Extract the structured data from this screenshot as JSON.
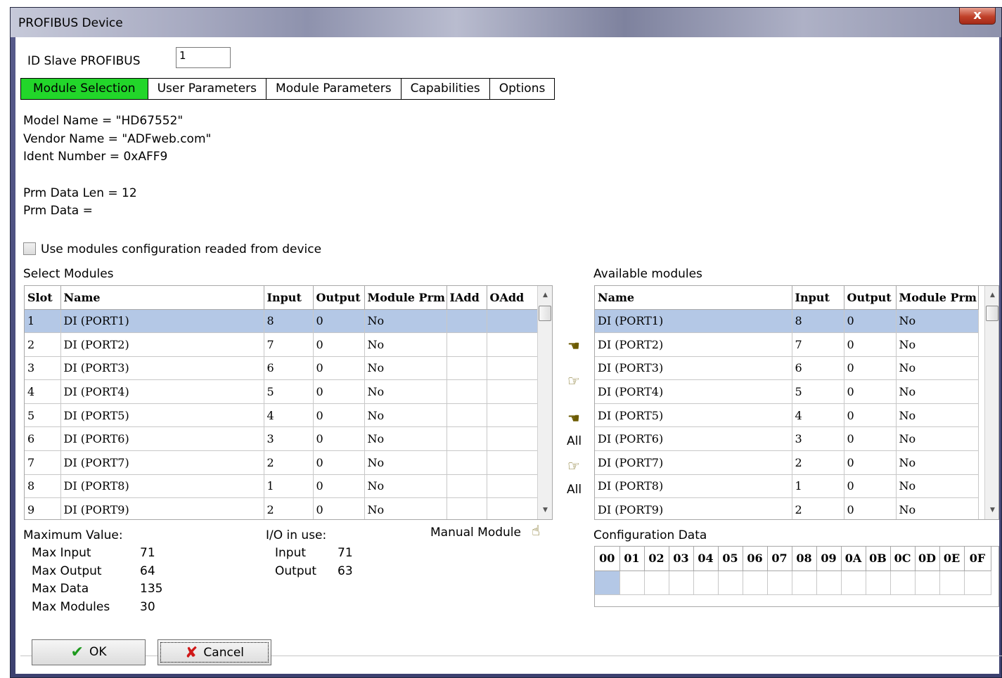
{
  "window": {
    "title": "PROFIBUS Device",
    "close_label": "x"
  },
  "id_slave": {
    "label": "ID Slave PROFIBUS",
    "value": "1"
  },
  "tabs": [
    {
      "label": "Module Selection",
      "active": true
    },
    {
      "label": "User Parameters",
      "active": false
    },
    {
      "label": "Module Parameters",
      "active": false
    },
    {
      "label": "Capabilities",
      "active": false
    },
    {
      "label": "Options",
      "active": false
    }
  ],
  "info": {
    "model_name": "Model Name = \"HD67552\"",
    "vendor_name": "Vendor Name = \"ADFweb.com\"",
    "ident_number": "Ident Number = 0xAFF9",
    "prm_data_len": "Prm Data Len = 12",
    "prm_data": "Prm Data ="
  },
  "use_modules_checkbox": {
    "label": "Use modules configuration readed from device",
    "checked": false
  },
  "select_modules": {
    "title": "Select Modules",
    "columns": [
      "Slot",
      "Name",
      "Input",
      "Output",
      "Module Prm",
      "IAdd",
      "OAdd"
    ],
    "rows": [
      [
        "1",
        "DI  (PORT1)",
        "8",
        "0",
        "No",
        "",
        ""
      ],
      [
        "2",
        "DI  (PORT2)",
        "7",
        "0",
        "No",
        "",
        ""
      ],
      [
        "3",
        "DI  (PORT3)",
        "6",
        "0",
        "No",
        "",
        ""
      ],
      [
        "4",
        "DI  (PORT4)",
        "5",
        "0",
        "No",
        "",
        ""
      ],
      [
        "5",
        "DI  (PORT5)",
        "4",
        "0",
        "No",
        "",
        ""
      ],
      [
        "6",
        "DI  (PORT6)",
        "3",
        "0",
        "No",
        "",
        ""
      ],
      [
        "7",
        "DI  (PORT7)",
        "2",
        "0",
        "No",
        "",
        ""
      ],
      [
        "8",
        "DI  (PORT8)",
        "1",
        "0",
        "No",
        "",
        ""
      ],
      [
        "9",
        "DI  (PORT9)",
        "2",
        "0",
        "No",
        "",
        ""
      ]
    ]
  },
  "available_modules": {
    "title": "Available modules",
    "columns": [
      "Name",
      "Input",
      "Output",
      "Module Prm"
    ],
    "rows": [
      [
        "DI  (PORT1)",
        "8",
        "0",
        "No"
      ],
      [
        "DI  (PORT2)",
        "7",
        "0",
        "No"
      ],
      [
        "DI  (PORT3)",
        "6",
        "0",
        "No"
      ],
      [
        "DI  (PORT4)",
        "5",
        "0",
        "No"
      ],
      [
        "DI  (PORT5)",
        "4",
        "0",
        "No"
      ],
      [
        "DI  (PORT6)",
        "3",
        "0",
        "No"
      ],
      [
        "DI  (PORT7)",
        "2",
        "0",
        "No"
      ],
      [
        "DI  (PORT8)",
        "1",
        "0",
        "No"
      ],
      [
        "DI  (PORT9)",
        "2",
        "0",
        "No"
      ]
    ]
  },
  "transfer_buttons": {
    "add_icon": "hand-pointing-left-icon",
    "remove_icon": "hand-pointing-right-icon",
    "add_all_label": "All",
    "remove_all_label": "All"
  },
  "maximum": {
    "title": "Maximum Value:",
    "items": [
      {
        "label": "Max Input",
        "value": "71"
      },
      {
        "label": "Max Output",
        "value": "64"
      },
      {
        "label": "Max Data",
        "value": "135"
      },
      {
        "label": "Max Modules",
        "value": "30"
      }
    ]
  },
  "io_in_use": {
    "title": "I/O in use:",
    "items": [
      {
        "label": "Input",
        "value": "71"
      },
      {
        "label": "Output",
        "value": "63"
      }
    ]
  },
  "manual_module": {
    "label": "Manual Module",
    "icon": "hand-click-icon"
  },
  "configuration_data": {
    "title": "Configuration Data",
    "columns": [
      "00",
      "01",
      "02",
      "03",
      "04",
      "05",
      "06",
      "07",
      "08",
      "09",
      "0A",
      "0B",
      "0C",
      "0D",
      "0E",
      "0F"
    ]
  },
  "buttons": {
    "ok": "OK",
    "cancel": "Cancel"
  },
  "colors": {
    "active_tab": "#22d62a",
    "selection": "#b4c8e6",
    "ok_check": "#1e9a1e",
    "cancel_x": "#d01818"
  }
}
